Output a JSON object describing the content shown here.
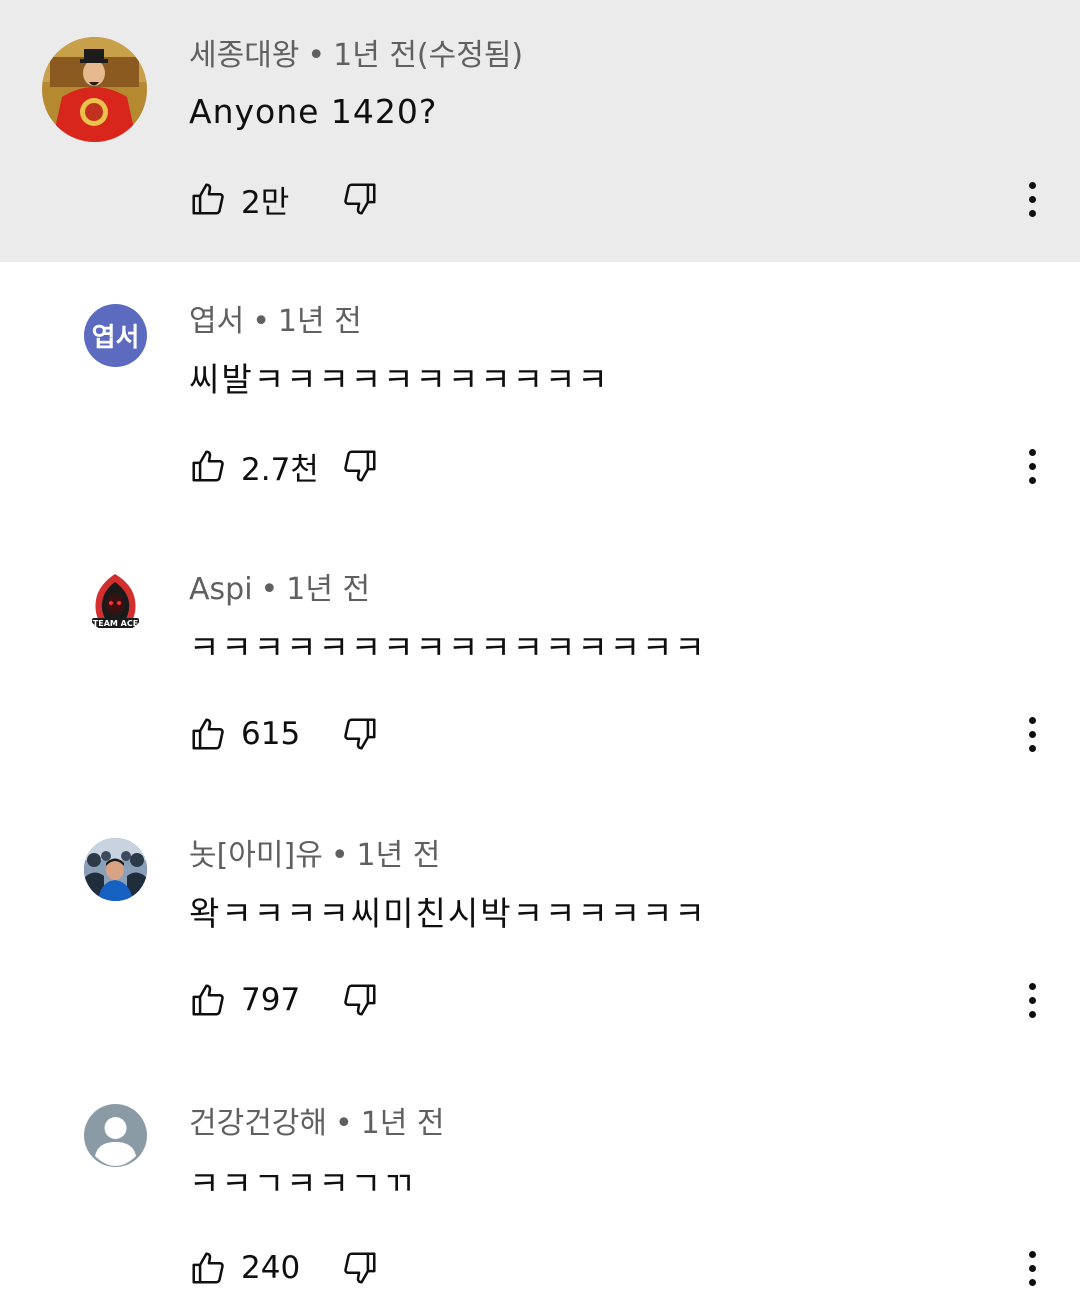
{
  "colors": {
    "highlight_bg": "#ebebeb",
    "meta_text": "#606060",
    "main_text": "#0f0f0f",
    "avatar_purple": "#5c6bc0",
    "avatar_gray": "#8a9ba5"
  },
  "icons": {
    "like": "thumb-up-outline",
    "dislike": "thumb-down-outline",
    "more": "vertical-ellipsis"
  },
  "comments": [
    {
      "author": "세종대왕",
      "time": "1년 전(수정됨)",
      "text": "Anyone 1420?",
      "likes": "2만",
      "highlighted": true,
      "avatar": "king-portrait"
    },
    {
      "author": "엽서",
      "time": "1년 전",
      "text": "씨발ㅋㅋㅋㅋㅋㅋㅋㅋㅋㅋㅋ",
      "likes": "2.7천",
      "avatar_initials": "엽서"
    },
    {
      "author": "Aspi",
      "time": "1년 전",
      "text": "ㅋㅋㅋㅋㅋㅋㅋㅋㅋㅋㅋㅋㅋㅋㅋㅋ",
      "likes": "615",
      "avatar": "team-ace-logo"
    },
    {
      "author": "놋[아미]유",
      "time": "1년 전",
      "text": "왁ㅋㅋㅋㅋ씨미친시박ㅋㅋㅋㅋㅋㅋ",
      "likes": "797",
      "avatar": "crowd-photo"
    },
    {
      "author": "건강건강해",
      "time": "1년 전",
      "text": "ㅋㅋㄱㅋㅋㄱㄲ",
      "likes": "240",
      "avatar": "default-person"
    }
  ]
}
